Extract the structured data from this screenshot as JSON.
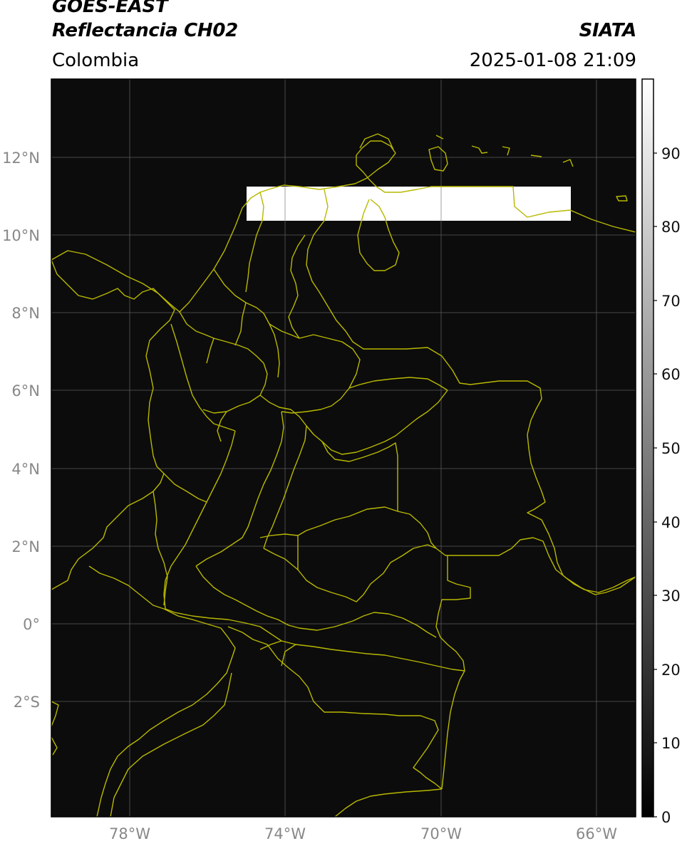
{
  "header": {
    "title_line1": "GOES-EAST",
    "title_line2": "Reflectancia CH02",
    "source": "SIATA",
    "region": "Colombia",
    "timestamp": "2025-01-08 21:09"
  },
  "map": {
    "background_color": "#0c0c0c",
    "border_color": "#b8b800",
    "gridline_color": "#6e6e6e",
    "lat_ticks": [
      "12°N",
      "10°N",
      "8°N",
      "6°N",
      "4°N",
      "2°N",
      "0°",
      "2°S"
    ],
    "lon_ticks": [
      "78°W",
      "74°W",
      "70°W",
      "66°W"
    ],
    "reflectance_band": {
      "lon_range": [
        -75.0,
        -66.7
      ],
      "lat_range": [
        10.3,
        11.3
      ],
      "value": 100
    }
  },
  "colorbar": {
    "ticks": [
      "0",
      "10",
      "20",
      "30",
      "40",
      "50",
      "60",
      "70",
      "80",
      "90"
    ],
    "min": 0,
    "max": 100,
    "color_low": "#000000",
    "color_high": "#ffffff"
  }
}
